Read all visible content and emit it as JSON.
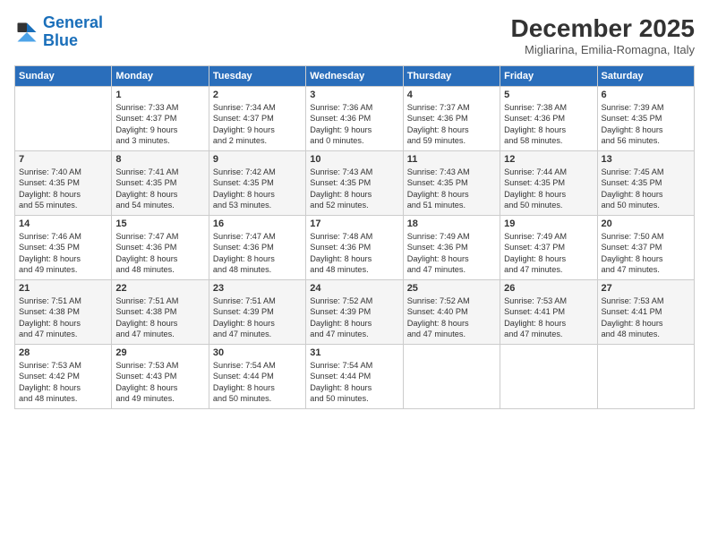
{
  "header": {
    "logo_line1": "General",
    "logo_line2": "Blue",
    "month": "December 2025",
    "location": "Migliarina, Emilia-Romagna, Italy"
  },
  "weekdays": [
    "Sunday",
    "Monday",
    "Tuesday",
    "Wednesday",
    "Thursday",
    "Friday",
    "Saturday"
  ],
  "weeks": [
    [
      {
        "day": "",
        "info": ""
      },
      {
        "day": "1",
        "info": "Sunrise: 7:33 AM\nSunset: 4:37 PM\nDaylight: 9 hours\nand 3 minutes."
      },
      {
        "day": "2",
        "info": "Sunrise: 7:34 AM\nSunset: 4:37 PM\nDaylight: 9 hours\nand 2 minutes."
      },
      {
        "day": "3",
        "info": "Sunrise: 7:36 AM\nSunset: 4:36 PM\nDaylight: 9 hours\nand 0 minutes."
      },
      {
        "day": "4",
        "info": "Sunrise: 7:37 AM\nSunset: 4:36 PM\nDaylight: 8 hours\nand 59 minutes."
      },
      {
        "day": "5",
        "info": "Sunrise: 7:38 AM\nSunset: 4:36 PM\nDaylight: 8 hours\nand 58 minutes."
      },
      {
        "day": "6",
        "info": "Sunrise: 7:39 AM\nSunset: 4:35 PM\nDaylight: 8 hours\nand 56 minutes."
      }
    ],
    [
      {
        "day": "7",
        "info": "Sunrise: 7:40 AM\nSunset: 4:35 PM\nDaylight: 8 hours\nand 55 minutes."
      },
      {
        "day": "8",
        "info": "Sunrise: 7:41 AM\nSunset: 4:35 PM\nDaylight: 8 hours\nand 54 minutes."
      },
      {
        "day": "9",
        "info": "Sunrise: 7:42 AM\nSunset: 4:35 PM\nDaylight: 8 hours\nand 53 minutes."
      },
      {
        "day": "10",
        "info": "Sunrise: 7:43 AM\nSunset: 4:35 PM\nDaylight: 8 hours\nand 52 minutes."
      },
      {
        "day": "11",
        "info": "Sunrise: 7:43 AM\nSunset: 4:35 PM\nDaylight: 8 hours\nand 51 minutes."
      },
      {
        "day": "12",
        "info": "Sunrise: 7:44 AM\nSunset: 4:35 PM\nDaylight: 8 hours\nand 50 minutes."
      },
      {
        "day": "13",
        "info": "Sunrise: 7:45 AM\nSunset: 4:35 PM\nDaylight: 8 hours\nand 50 minutes."
      }
    ],
    [
      {
        "day": "14",
        "info": "Sunrise: 7:46 AM\nSunset: 4:35 PM\nDaylight: 8 hours\nand 49 minutes."
      },
      {
        "day": "15",
        "info": "Sunrise: 7:47 AM\nSunset: 4:36 PM\nDaylight: 8 hours\nand 48 minutes."
      },
      {
        "day": "16",
        "info": "Sunrise: 7:47 AM\nSunset: 4:36 PM\nDaylight: 8 hours\nand 48 minutes."
      },
      {
        "day": "17",
        "info": "Sunrise: 7:48 AM\nSunset: 4:36 PM\nDaylight: 8 hours\nand 48 minutes."
      },
      {
        "day": "18",
        "info": "Sunrise: 7:49 AM\nSunset: 4:36 PM\nDaylight: 8 hours\nand 47 minutes."
      },
      {
        "day": "19",
        "info": "Sunrise: 7:49 AM\nSunset: 4:37 PM\nDaylight: 8 hours\nand 47 minutes."
      },
      {
        "day": "20",
        "info": "Sunrise: 7:50 AM\nSunset: 4:37 PM\nDaylight: 8 hours\nand 47 minutes."
      }
    ],
    [
      {
        "day": "21",
        "info": "Sunrise: 7:51 AM\nSunset: 4:38 PM\nDaylight: 8 hours\nand 47 minutes."
      },
      {
        "day": "22",
        "info": "Sunrise: 7:51 AM\nSunset: 4:38 PM\nDaylight: 8 hours\nand 47 minutes."
      },
      {
        "day": "23",
        "info": "Sunrise: 7:51 AM\nSunset: 4:39 PM\nDaylight: 8 hours\nand 47 minutes."
      },
      {
        "day": "24",
        "info": "Sunrise: 7:52 AM\nSunset: 4:39 PM\nDaylight: 8 hours\nand 47 minutes."
      },
      {
        "day": "25",
        "info": "Sunrise: 7:52 AM\nSunset: 4:40 PM\nDaylight: 8 hours\nand 47 minutes."
      },
      {
        "day": "26",
        "info": "Sunrise: 7:53 AM\nSunset: 4:41 PM\nDaylight: 8 hours\nand 47 minutes."
      },
      {
        "day": "27",
        "info": "Sunrise: 7:53 AM\nSunset: 4:41 PM\nDaylight: 8 hours\nand 48 minutes."
      }
    ],
    [
      {
        "day": "28",
        "info": "Sunrise: 7:53 AM\nSunset: 4:42 PM\nDaylight: 8 hours\nand 48 minutes."
      },
      {
        "day": "29",
        "info": "Sunrise: 7:53 AM\nSunset: 4:43 PM\nDaylight: 8 hours\nand 49 minutes."
      },
      {
        "day": "30",
        "info": "Sunrise: 7:54 AM\nSunset: 4:44 PM\nDaylight: 8 hours\nand 50 minutes."
      },
      {
        "day": "31",
        "info": "Sunrise: 7:54 AM\nSunset: 4:44 PM\nDaylight: 8 hours\nand 50 minutes."
      },
      {
        "day": "",
        "info": ""
      },
      {
        "day": "",
        "info": ""
      },
      {
        "day": "",
        "info": ""
      }
    ]
  ]
}
